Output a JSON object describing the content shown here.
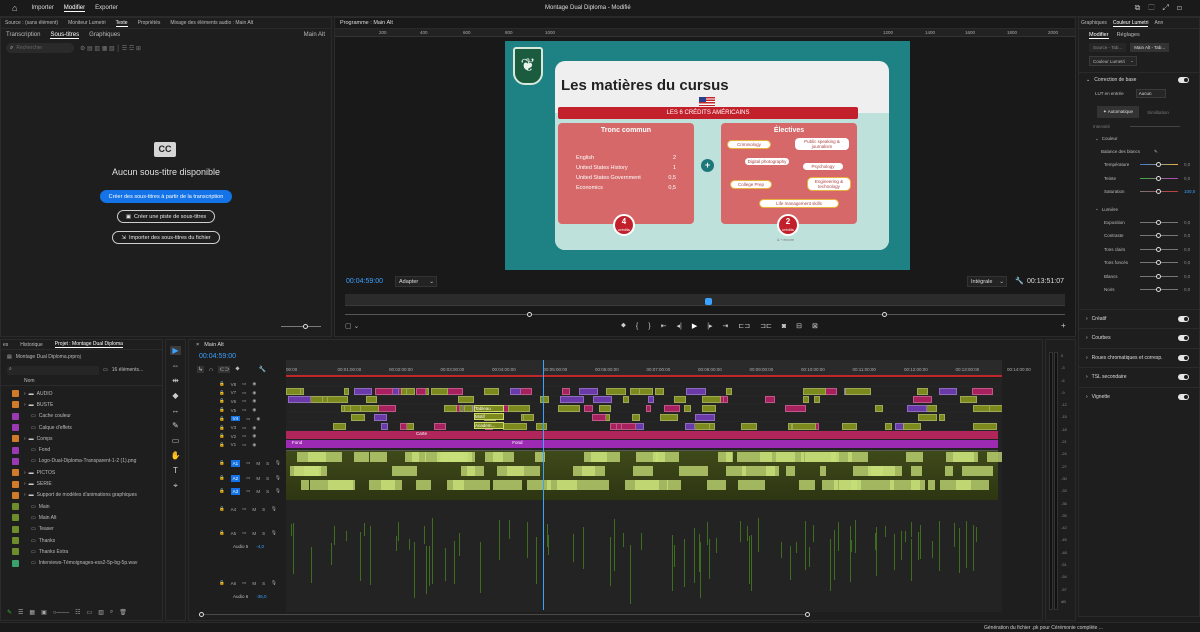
{
  "app": {
    "menu": [
      "Importer",
      "Modifier",
      "Exporter"
    ],
    "active_menu": "Modifier",
    "title": "Montage Dual Diploma - Modifié",
    "status": "Génération du fichier .pk pour Cérémonie complète ..."
  },
  "source_panel": {
    "tabs": [
      "Source : (sans élément)",
      "Moniteur Lumetri",
      "Texte",
      "Propriétés",
      "Mixage des éléments audio : Main Alt"
    ],
    "active_tab": "Texte",
    "subtabs": [
      "Transcription",
      "Sous-titres",
      "Graphiques"
    ],
    "active_subtab": "Sous-titres",
    "sequence": "Main Alt",
    "search_placeholder": "Rechercher",
    "cc_icon": "CC",
    "empty_title": "Aucun sous-titre disponible",
    "btn_create_from_transcript": "Créer des sous-titres à partir de la transcription",
    "btn_create_track": "Créer une piste de sous-titres",
    "btn_import": "Importer des sous-titres du fichier"
  },
  "program": {
    "title": "Programme : Main Alt",
    "timecode": "00:04:59:00",
    "fit": "Adapter",
    "quality": "Intégrale",
    "duration": "00:13:51:07",
    "ruler": [
      "200",
      "400",
      "600",
      "800",
      "1000",
      "1200",
      "1400",
      "1600",
      "1800",
      "2000"
    ]
  },
  "slide": {
    "title": "Les matières du cursus",
    "banner": "LES 6 CRÉDITS AMÉRICAINS",
    "tronc_title": "Tronc commun",
    "courses": [
      {
        "name": "English",
        "credits": "2"
      },
      {
        "name": "United States History",
        "credits": "1"
      },
      {
        "name": "United States Government",
        "credits": "0,5"
      },
      {
        "name": "Economics",
        "credits": "0,5"
      }
    ],
    "left_badge_num": "4",
    "left_badge_lbl": "crédits",
    "electives_title": "Électives",
    "electives": [
      "Criminology",
      "Public speaking & journalism",
      "Digital photography",
      "Psychology",
      "College Prep",
      "Engineering & technology",
      "Life management skills"
    ],
    "right_badge_num": "2",
    "right_badge_lbl": "crédits",
    "footnote": "& + encore"
  },
  "project": {
    "tabs": [
      "es",
      "Historique",
      "Projet : Montage Dual Diploma"
    ],
    "file": "Montage Dual Diploma.prproj",
    "count": "16 éléments...",
    "col": "Nom",
    "items": [
      {
        "name": "AUDIO",
        "color": "#d07b2a",
        "folder": true
      },
      {
        "name": "BUSTE",
        "color": "#d07b2a",
        "folder": true
      },
      {
        "name": "Cache couleur",
        "color": "#9a3ab2",
        "folder": false
      },
      {
        "name": "Calque d'effets",
        "color": "#9a3ab2",
        "folder": false
      },
      {
        "name": "Comps",
        "color": "#d07b2a",
        "folder": true
      },
      {
        "name": "Fond",
        "color": "#9a3ab2",
        "folder": false
      },
      {
        "name": "Logo-Dual-Diploma-Transparent-1-2 (1).png",
        "color": "#9a3ab2",
        "folder": false
      },
      {
        "name": "PICTOS",
        "color": "#d07b2a",
        "folder": true
      },
      {
        "name": "SERIE",
        "color": "#d07b2a",
        "folder": true
      },
      {
        "name": "Support de modèles d'animations graphiques",
        "color": "#d07b2a",
        "folder": true
      },
      {
        "name": "Main",
        "color": "#6d8c2c",
        "folder": false
      },
      {
        "name": "Main Alt",
        "color": "#6d8c2c",
        "folder": false
      },
      {
        "name": "Teaser",
        "color": "#6d8c2c",
        "folder": false
      },
      {
        "name": "Thanks",
        "color": "#6d8c2c",
        "folder": false
      },
      {
        "name": "Thanks Extra",
        "color": "#6d8c2c",
        "folder": false
      },
      {
        "name": "Interviews-Témoignages-ess2-5p-bg-5p.wav",
        "color": "#3aa06c",
        "folder": false
      }
    ]
  },
  "timeline": {
    "tab": "Main Alt",
    "timecode": "00:04:59:00",
    "ruler": [
      "00:00",
      "00:01:00:00",
      "00:02:00:00",
      "00:03:00:00",
      "00:04:00:00",
      "00:05:00:00",
      "00:06:00:00",
      "00:07:00:00",
      "00:08:00:00",
      "00:09:00:00",
      "00:10:00:00",
      "00:11:00:00",
      "00:12:00:00",
      "00:13:00:00",
      "00:14:00:00"
    ],
    "video_tracks": [
      "V8",
      "V7",
      "V6",
      "V5",
      "V4",
      "V3",
      "V2",
      "V1"
    ],
    "audio_tracks": [
      "A1",
      "A2",
      "A3",
      "A4",
      "A5",
      "A6"
    ],
    "a5_name": "Audio 5",
    "a5_val": "-4,0",
    "a6_name": "Audio 6",
    "a6_val": "-35,0",
    "clip_labels": [
      "Tableau",
      "Motif",
      "Academ...",
      "Carte",
      "Fond",
      "Fond"
    ],
    "meter": [
      "0",
      "-3",
      "-6",
      "-9",
      "-12",
      "-15",
      "-18",
      "-21",
      "-24",
      "-27",
      "-30",
      "-33",
      "-36",
      "-39",
      "-42",
      "-45",
      "-48",
      "-51",
      "-54",
      "-57",
      "dB"
    ]
  },
  "lumetri": {
    "tabs": [
      "Graphiques",
      "Couleur Lumetri",
      "Ann"
    ],
    "active": "Couleur Lumetri",
    "subtabs": [
      "Modifier",
      "Réglages"
    ],
    "source": "Source - Tab...",
    "seq": "Main Alt - Tab...",
    "effect": "Couleur Lumetri",
    "section_base": "Correction de base",
    "lut_label": "LUT en entrée",
    "lut_val": "Aucun",
    "auto": "Automatique",
    "reset": "Similitation",
    "intensity": "Intensité",
    "color_head": "Couleur",
    "wb": "Balance des blancs",
    "color_rows": [
      {
        "l": "Température",
        "v": "0,0"
      },
      {
        "l": "Teinte",
        "v": "0,0"
      },
      {
        "l": "Saturation",
        "v": "100,0"
      }
    ],
    "light_head": "Lumière",
    "light_rows": [
      {
        "l": "Exposition",
        "v": "0,0"
      },
      {
        "l": "Contraste",
        "v": "0,0"
      },
      {
        "l": "Tons clairs",
        "v": "0,0"
      },
      {
        "l": "Tons foncés",
        "v": "0,0"
      },
      {
        "l": "Blancs",
        "v": "0,0"
      },
      {
        "l": "Noirs",
        "v": "0,0"
      }
    ],
    "sections": [
      "Créatif",
      "Courbes",
      "Roues chromatiques et corresp.",
      "TSL secondaire",
      "Vignette"
    ]
  }
}
